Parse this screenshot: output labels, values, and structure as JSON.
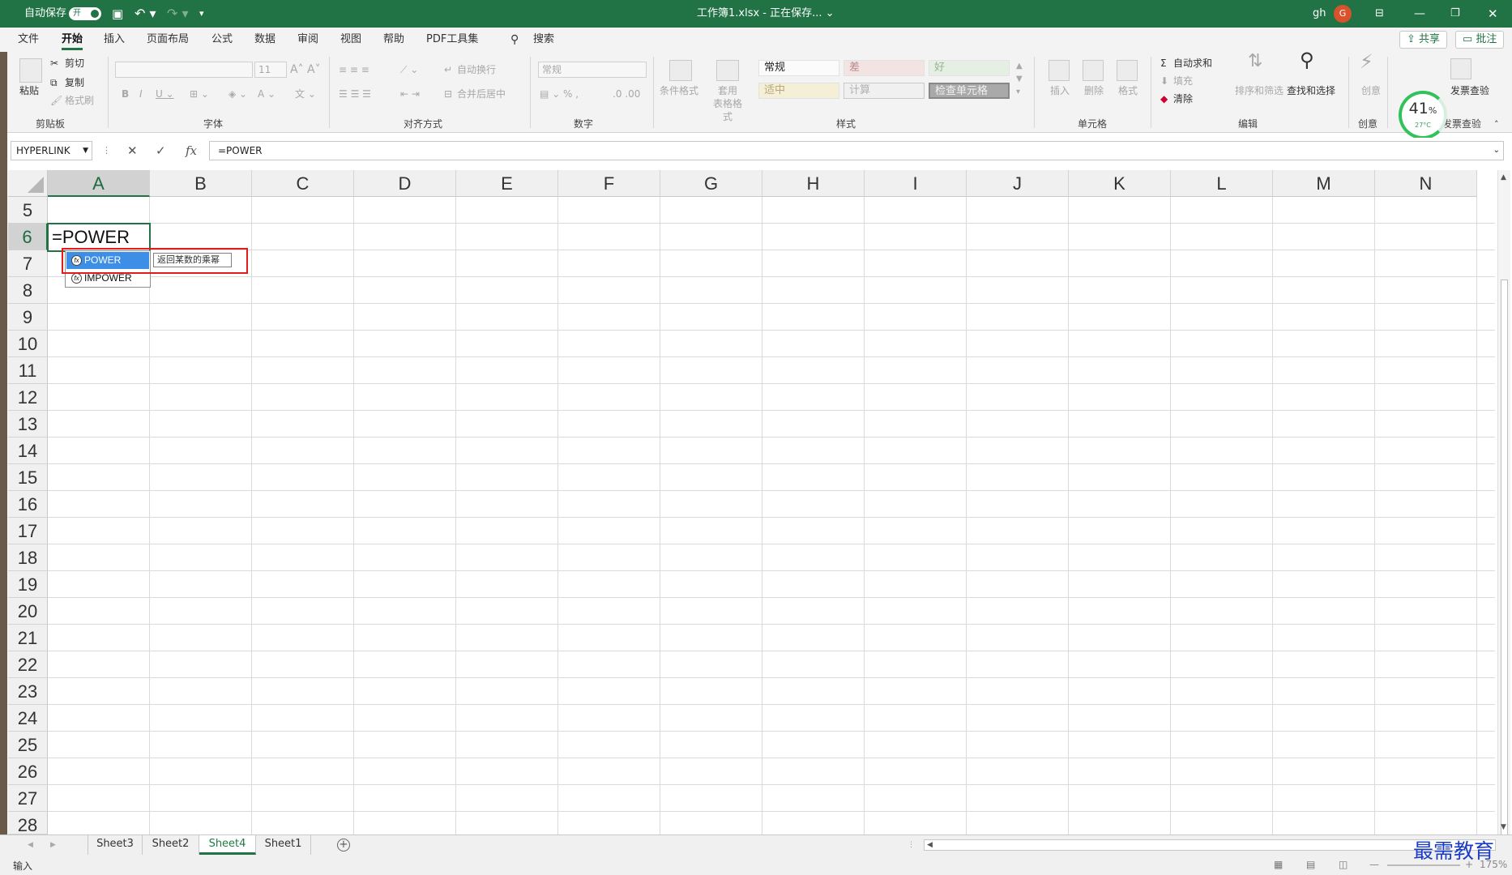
{
  "titlebar": {
    "autosave_label": "自动保存",
    "autosave_state": "开",
    "doc_title": "工作簿1.xlsx - 正在保存... ⌄",
    "user": "gh",
    "avatar_letter": "G",
    "accent_color": "#217346"
  },
  "menu": {
    "tabs": [
      "文件",
      "开始",
      "插入",
      "页面布局",
      "公式",
      "数据",
      "审阅",
      "视图",
      "帮助",
      "PDF工具集"
    ],
    "active_tab": "开始",
    "search_label": "搜索",
    "share_label": "共享",
    "comment_label": "批注"
  },
  "ribbon": {
    "clipboard": {
      "paste": "粘贴",
      "cut": "剪切",
      "copy": "复制",
      "format_painter": "格式刷",
      "group_label": "剪贴板"
    },
    "font": {
      "size": "11",
      "group_label": "字体"
    },
    "alignment": {
      "wrap": "自动换行",
      "merge": "合并后居中",
      "group_label": "对齐方式"
    },
    "number": {
      "format": "常规",
      "group_label": "数字"
    },
    "styles": {
      "conditional": "条件格式",
      "table_format": "套用\n表格格式",
      "cells": [
        "常规",
        "差",
        "好",
        "适中",
        "计算",
        "检查单元格"
      ],
      "group_label": "样式"
    },
    "cells_group": {
      "insert": "插入",
      "delete": "删除",
      "format": "格式",
      "group_label": "单元格"
    },
    "editing": {
      "autosum": "自动求和",
      "fill": "填充",
      "clear": "清除",
      "sort": "排序和筛选",
      "find": "查找和选择",
      "group_label": "编辑"
    },
    "creative": {
      "label": "创意",
      "btn": "创意"
    },
    "invoice": {
      "btn": "发票查验",
      "group_label": "发票查验"
    },
    "gauge": {
      "percent": "41",
      "unit": "%",
      "temp": "27°C"
    }
  },
  "formula_bar": {
    "name_box": "HYPERLINK",
    "cancel": "✕",
    "enter": "✓",
    "fx": "fx",
    "formula": "=POWER"
  },
  "grid": {
    "columns": [
      "A",
      "B",
      "C",
      "D",
      "E",
      "F",
      "G",
      "H",
      "I",
      "J",
      "K",
      "L",
      "M",
      "N"
    ],
    "rows": [
      "5",
      "6",
      "7",
      "8",
      "9",
      "10",
      "11",
      "12",
      "13",
      "14",
      "15",
      "16",
      "17",
      "18",
      "19",
      "20",
      "21",
      "22",
      "23",
      "24",
      "25",
      "26",
      "27",
      "28"
    ],
    "active_column": "A",
    "active_row": "6",
    "active_cell_text": "=POWER"
  },
  "autocomplete": {
    "items": [
      "POWER",
      "IMPOWER"
    ],
    "selected": "POWER",
    "tooltip": "返回某数的乘幂"
  },
  "sheets": {
    "tabs": [
      "Sheet3",
      "Sheet2",
      "Sheet4",
      "Sheet1"
    ],
    "active": "Sheet4"
  },
  "statusbar": {
    "mode": "输入",
    "zoom": "175%"
  },
  "watermark": "最需教育"
}
